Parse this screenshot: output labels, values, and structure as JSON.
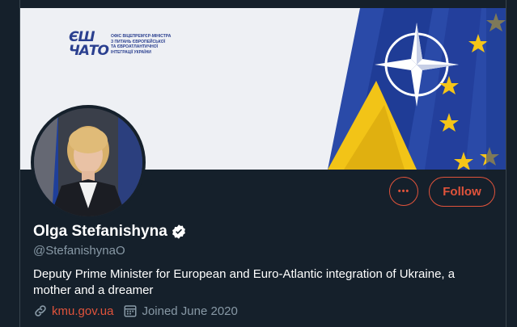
{
  "banner": {
    "logo_mark_line1": "ЄШ",
    "logo_mark_line2": "ЧАТО",
    "logo_text": "Офіс віцепрем'єр-міністра\nз питань європейської\nта євроатлантичної\nінтеграції України"
  },
  "profile": {
    "name": "Olga Stefanishyna",
    "handle": "@StefanishynaO",
    "bio": "Deputy Prime Minister for European and Euro-Atlantic integration of Ukraine, a mother and a dreamer",
    "website": "kmu.gov.ua",
    "joined": "Joined June 2020"
  },
  "actions": {
    "more_label": "•••",
    "follow_label": "Follow"
  },
  "colors": {
    "accent": "#e0533b",
    "background": "#15202b",
    "secondary_text": "#8899a6"
  },
  "icons": {
    "verified": "verified-badge-icon",
    "link": "link-icon",
    "calendar": "calendar-icon",
    "more": "more-options-icon"
  }
}
